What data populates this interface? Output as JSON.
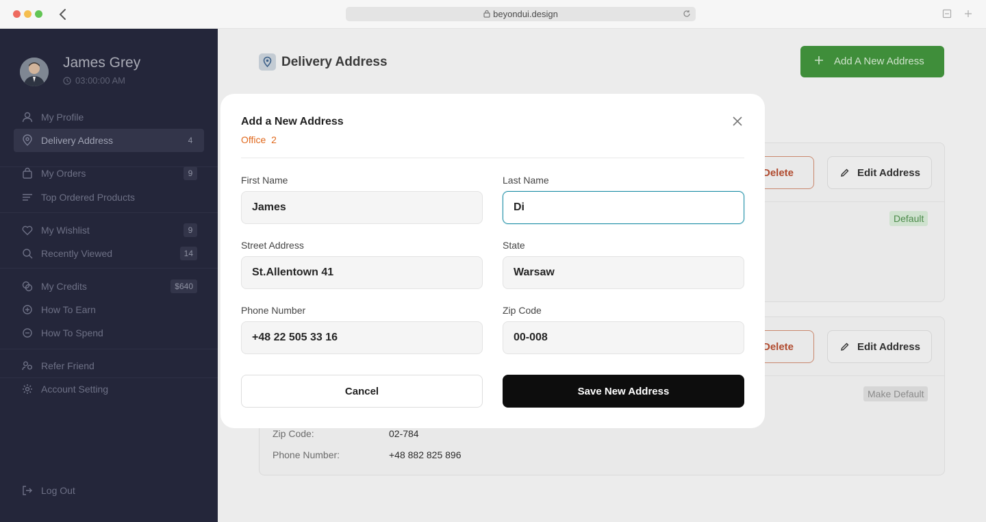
{
  "browser": {
    "url": "beyondui.design"
  },
  "sidebar": {
    "user": {
      "name": "James Grey",
      "time": "03:00:00 AM"
    },
    "items": [
      {
        "label": "My Profile",
        "count": "",
        "icon": "user-icon"
      },
      {
        "label": "Delivery Address",
        "count": "4",
        "icon": "location-pin-icon",
        "active": true
      },
      {
        "label": "My Orders",
        "count": "9",
        "icon": "shopping-bag-icon"
      },
      {
        "label": "Top Ordered Products",
        "count": "",
        "icon": "list-icon"
      },
      {
        "label": "My Wishlist",
        "count": "9",
        "icon": "heart-icon"
      },
      {
        "label": "Recently Viewed",
        "count": "14",
        "icon": "search-icon"
      },
      {
        "label": "My Credits",
        "count": "$640",
        "icon": "coins-icon"
      },
      {
        "label": "How To Earn",
        "count": "",
        "icon": "coin-plus-icon"
      },
      {
        "label": "How To Spend",
        "count": "",
        "icon": "coin-minus-icon"
      },
      {
        "label": "Refer Friend",
        "count": "",
        "icon": "users-icon"
      },
      {
        "label": "Account Setting",
        "count": "",
        "icon": "gear-icon"
      }
    ],
    "logout": "Log Out"
  },
  "main": {
    "title": "Delivery Address",
    "add_button": "Add A New Address",
    "cards": [
      {
        "delete": "Delete",
        "edit": "Edit Address",
        "badge": "Default"
      },
      {
        "delete": "Delete",
        "edit": "Edit Address",
        "badge": "Make Default",
        "rows": [
          {
            "label": "Zip Code:",
            "value": "02-784"
          },
          {
            "label": "Phone Number:",
            "value": "+48 882 825 896"
          }
        ]
      }
    ]
  },
  "modal": {
    "title": "Add a New Address",
    "subtitle": "Office  2",
    "fields": {
      "first_name": {
        "label": "First Name",
        "value": "James"
      },
      "last_name": {
        "label": "Last Name",
        "value": "Di"
      },
      "street": {
        "label": "Street Address",
        "value": "St.Allentown 41"
      },
      "state": {
        "label": "State",
        "value": "Warsaw"
      },
      "phone": {
        "label": "Phone Number",
        "value": "+48 22 505 33 16"
      },
      "zip": {
        "label": "Zip Code",
        "value": "00-008"
      }
    },
    "cancel": "Cancel",
    "save": "Save New Address"
  },
  "colors": {
    "sidebar_bg": "#24263a",
    "primary_green": "#3f8e3a",
    "accent_orange": "#e0681c",
    "focus_teal": "#1e8fa6",
    "save_black": "#0d0d0d"
  }
}
